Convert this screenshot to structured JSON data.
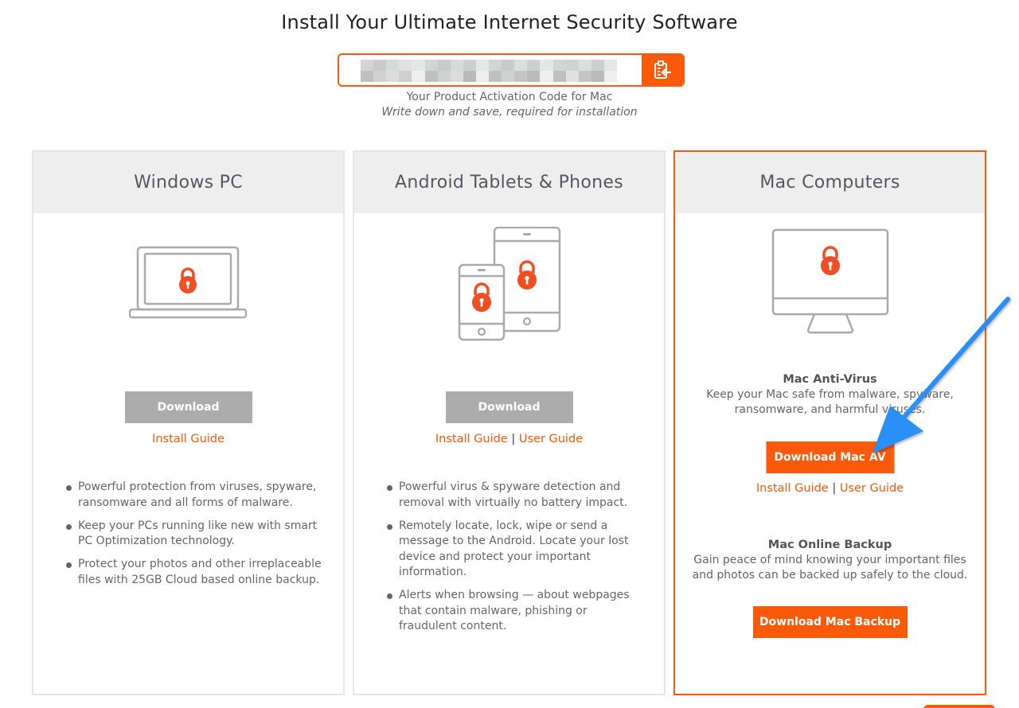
{
  "page": {
    "title": "Install Your Ultimate Internet Security Software"
  },
  "activation": {
    "code_value": "",
    "code_obscured": true,
    "caption": "Your Product Activation Code for Mac",
    "subcaption": "Write down and save, required for installation",
    "copy_icon": "clipboard-copy-icon"
  },
  "cards": [
    {
      "title": "Windows PC",
      "icon": "laptop-lock-icon",
      "selected": false,
      "download_label": "Download",
      "links": [
        "Install Guide"
      ],
      "features": [
        "Powerful protection from viruses, spyware, ransomware and all forms of malware.",
        "Keep your PCs running like new with smart PC Optimization technology.",
        "Protect your photos and other irreplaceable files with 25GB Cloud based online backup."
      ]
    },
    {
      "title": "Android Tablets & Phones",
      "icon": "phone-tablet-lock-icon",
      "selected": false,
      "download_label": "Download",
      "links": [
        "Install Guide",
        "User Guide"
      ],
      "link_separator": "|",
      "features": [
        "Powerful virus & spyware detection and removal with virtually no battery impact.",
        "Remotely locate, lock, wipe or send a message to the Android. Locate your lost device and protect your important information.",
        "Alerts when browsing — about webpages that contain malware, phishing or fraudulent content."
      ]
    },
    {
      "title": "Mac Computers",
      "icon": "desktop-monitor-lock-icon",
      "selected": true,
      "products": [
        {
          "title": "Mac Anti-Virus",
          "description_line1": "Keep your Mac safe from malware, spyware,",
          "description_line2": "ransomware, and harmful viruses.",
          "download_label": "Download Mac AV",
          "links": [
            "Install Guide",
            "User Guide"
          ],
          "link_separator": "|"
        },
        {
          "title": "Mac Online Backup",
          "description_line1": "Gain peace of mind knowing your important files",
          "description_line2": "and photos can be backed up safely to the cloud.",
          "download_label": "Download Mac Backup"
        }
      ]
    }
  ],
  "colors": {
    "accent": "#fa5a0a",
    "disabled_button": "#acacac",
    "card_header_bg": "#eeeeee",
    "card_border": "#e6e6e6",
    "annotation_arrow": "#2a8ff7"
  },
  "annotation": {
    "type": "arrow",
    "points_to": "Download Mac AV"
  }
}
